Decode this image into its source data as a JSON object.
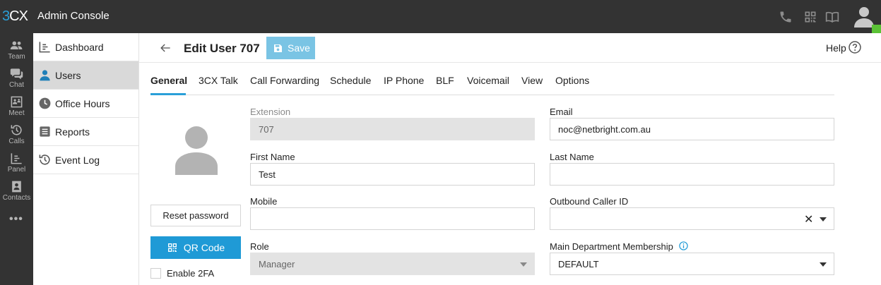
{
  "app": {
    "logo_prefix": "3",
    "logo_suffix": "CX",
    "title": "Admin Console"
  },
  "topbar_icons": [
    "phone-icon",
    "qr-icon",
    "book-icon",
    "user-avatar-icon"
  ],
  "rail": {
    "items": [
      {
        "label": "Team",
        "icon": "team-icon"
      },
      {
        "label": "Chat",
        "icon": "chat-icon"
      },
      {
        "label": "Meet",
        "icon": "meet-icon"
      },
      {
        "label": "Calls",
        "icon": "calls-history-icon"
      },
      {
        "label": "Panel",
        "icon": "panel-icon"
      },
      {
        "label": "Contacts",
        "icon": "contacts-icon"
      }
    ],
    "more": "•••"
  },
  "nav": {
    "items": [
      {
        "label": "Dashboard",
        "icon": "dashboard-icon",
        "active": false
      },
      {
        "label": "Users",
        "icon": "user-icon",
        "active": true
      },
      {
        "label": "Office Hours",
        "icon": "clock-icon",
        "active": false
      },
      {
        "label": "Reports",
        "icon": "reports-icon",
        "active": false
      },
      {
        "label": "Event Log",
        "icon": "history-icon",
        "active": false
      }
    ]
  },
  "header": {
    "title": "Edit User 707",
    "save_label": "Save",
    "help_label": "Help"
  },
  "tabs": [
    "General",
    "3CX Talk",
    "Call Forwarding",
    "Schedule",
    "IP Phone",
    "BLF",
    "Voicemail",
    "View",
    "Options"
  ],
  "active_tab": "General",
  "profile": {
    "reset_password_label": "Reset password",
    "qr_code_label": "QR Code",
    "enable_2fa_label": "Enable 2FA",
    "enable_2fa_checked": false
  },
  "form": {
    "extension": {
      "label": "Extension",
      "value": "707"
    },
    "email": {
      "label": "Email",
      "value": "noc@netbright.com.au"
    },
    "first_name": {
      "label": "First Name",
      "value": "Test"
    },
    "last_name": {
      "label": "Last Name",
      "value": ""
    },
    "mobile": {
      "label": "Mobile",
      "value": ""
    },
    "outbound_caller_id": {
      "label": "Outbound Caller ID",
      "value": "",
      "clear_glyph": "✕"
    },
    "role": {
      "label": "Role",
      "value": "Manager"
    },
    "main_department": {
      "label": "Main Department Membership",
      "value": "DEFAULT"
    }
  },
  "colors": {
    "topbar": "#333333",
    "accent": "#1f9ad6",
    "save_button": "#7ac4e4",
    "active_nav": "#d9d9d9",
    "status_online": "#5bc236"
  }
}
